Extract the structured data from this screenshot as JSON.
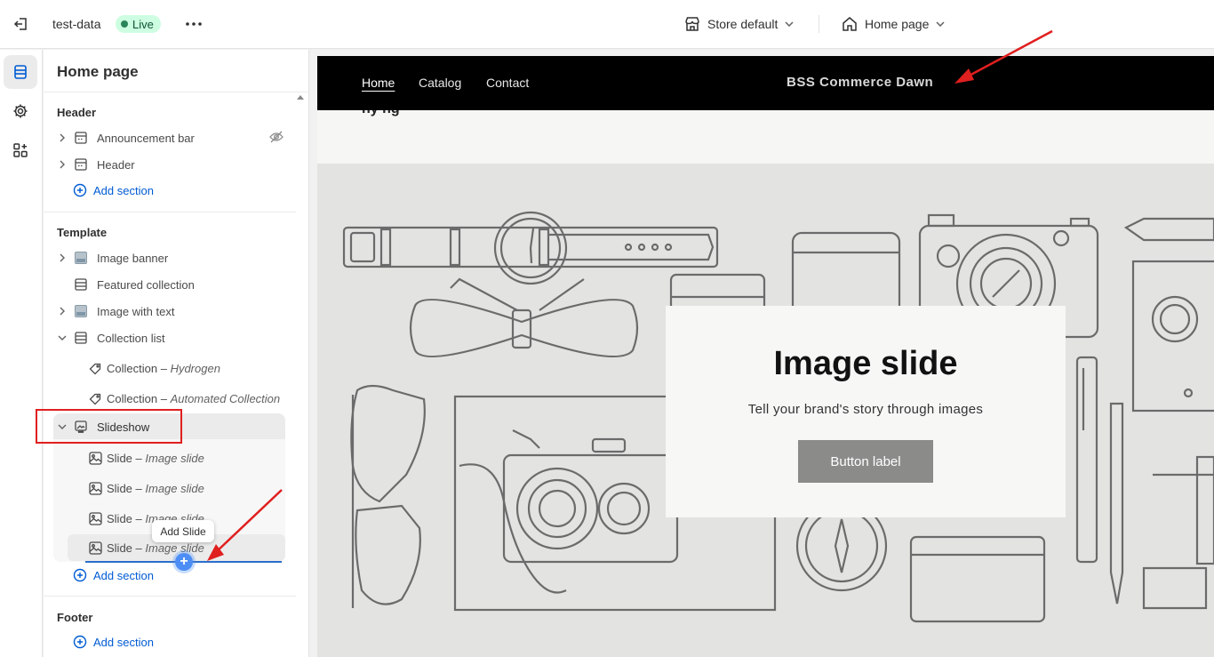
{
  "topbar": {
    "store_name": "test-data",
    "live_label": "Live",
    "store_select_label": "Store default",
    "page_select_label": "Home page"
  },
  "sidebar": {
    "title": "Home page",
    "header_group": {
      "title": "Header",
      "items": [
        {
          "label": "Announcement bar"
        },
        {
          "label": "Header"
        }
      ],
      "add_section": "Add section"
    },
    "template_group": {
      "title": "Template",
      "items": [
        {
          "label": "Image banner"
        },
        {
          "label": "Featured collection"
        },
        {
          "label": "Image with text"
        },
        {
          "label": "Collection list"
        }
      ],
      "collection_blocks": [
        {
          "label": "Collection",
          "sub": "Hydrogen"
        },
        {
          "label": "Collection",
          "sub": "Automated Collection"
        }
      ],
      "slideshow_label": "Slideshow",
      "slides": [
        {
          "label": "Slide",
          "sub": "Image slide"
        },
        {
          "label": "Slide",
          "sub": "Image slide"
        },
        {
          "label": "Slide",
          "sub": "Image slide"
        },
        {
          "label": "Slide",
          "sub": "Image slide"
        }
      ],
      "separator": " – ",
      "tooltip": "Add Slide",
      "add_section": "Add section"
    },
    "footer_group": {
      "title": "Footer",
      "add_section": "Add section"
    }
  },
  "preview": {
    "nav": [
      "Home",
      "Catalog",
      "Contact"
    ],
    "brand": "BSS Commerce Dawn",
    "band_text": "ny ng",
    "slide_title": "Image slide",
    "slide_text": "Tell your brand's story through images",
    "slide_button": "Button label"
  },
  "colors": {
    "accent": "#005bd3",
    "live_badge_bg": "#cdfee1",
    "annotation_red": "#e01f1f"
  }
}
